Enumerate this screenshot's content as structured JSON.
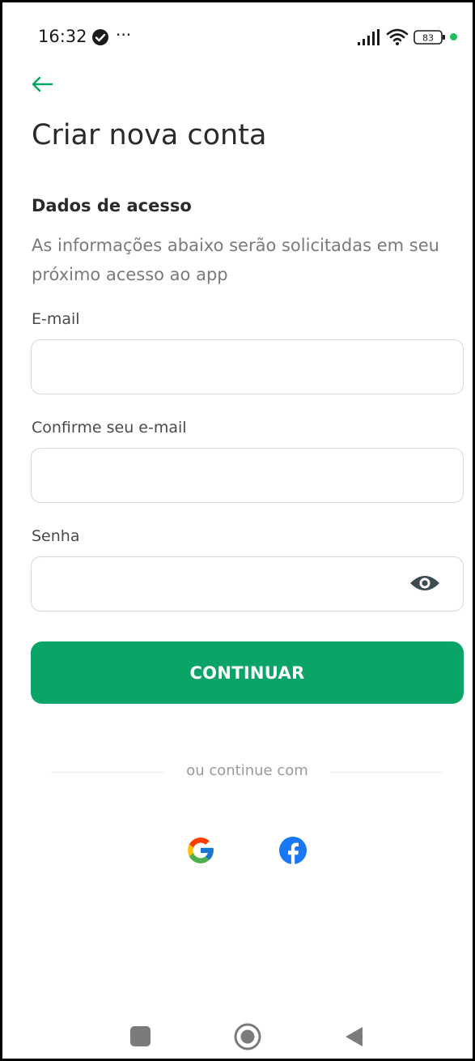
{
  "status_bar": {
    "time": "16:32",
    "more_indicator": "···",
    "battery_level": "83",
    "icons": [
      "check-circle-icon",
      "signal-icon",
      "wifi-icon",
      "battery-icon"
    ]
  },
  "header": {
    "back_icon": "arrow-left-icon",
    "title": "Criar nova conta"
  },
  "form": {
    "section_title": "Dados de acesso",
    "section_description": "As informações abaixo serão solicitadas em seu próximo acesso ao app",
    "email": {
      "label": "E-mail",
      "value": ""
    },
    "confirm_email": {
      "label": "Confirme seu e-mail",
      "value": ""
    },
    "password": {
      "label": "Senha",
      "value": "",
      "toggle_icon": "eye-icon"
    },
    "submit_label": "CONTINUAR"
  },
  "social": {
    "divider_text": "ou continue com",
    "providers": [
      "google-icon",
      "facebook-icon"
    ]
  },
  "nav_bar": {
    "icons": [
      "recents-icon",
      "home-icon",
      "back-icon"
    ]
  },
  "colors": {
    "accent": "#0aa466",
    "text_dark": "#2a2a2a",
    "text_muted": "#7a7a7a",
    "border": "#d7d7d7",
    "status_dot": "#1fbf5e"
  }
}
